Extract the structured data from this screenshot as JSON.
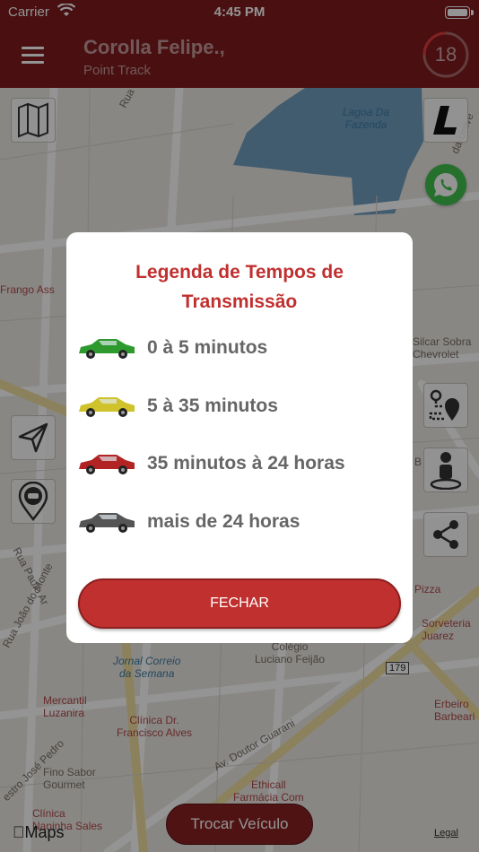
{
  "status_bar": {
    "carrier": "Carrier",
    "time": "4:45 PM"
  },
  "header": {
    "title": "Corolla Felipe.,",
    "subtitle": "Point Track",
    "counter": "18"
  },
  "map": {
    "labels": {
      "lagoa": "Lagoa Da\nFazenda",
      "rua_coronel": "Rua Coronel D",
      "frango": "Frango Ass",
      "silcar": "Silcar Sobra\nChevrolet",
      "rua_paulo": "Rua Paulo Ar",
      "rua_joao": "Rua João do Monte",
      "jornal": "Jornal Correio\nda Semana",
      "colegio": "Colégio\nLuciano Feijão",
      "road_179": "179",
      "pizza": "Pizza",
      "sorveteria": "Sorveteria\nJuarez",
      "erbeiro": "Erbeiro\nBarbeari",
      "mercantil": "Mercantil\nLuzanira",
      "clinica_dr": "Clínica Dr.\nFrancisco Alves",
      "av_doutor": "Av. Doutor Guarani",
      "jose_pedro": "estro José Pedro",
      "fino_sabor": "Fino Sabor\nGourmet",
      "ethicall": "Ethicall\nFarmácia Com\nManipulação",
      "clinica_naninha": "Clínica\nNaninha Sales",
      "rua_univ": "da Unive",
      "rua_b": "B"
    },
    "legal": "Legal",
    "brand": "Maps",
    "trocar_label": "Trocar Veículo"
  },
  "modal": {
    "title": "Legenda de Tempos de Transmissão",
    "items": [
      {
        "label": "0 à 5 minutos",
        "color": "#2e9a2e"
      },
      {
        "label": "5 à 35 minutos",
        "color": "#cfc22a"
      },
      {
        "label": "35 minutos à 24 horas",
        "color": "#b22323"
      },
      {
        "label": "mais de 24 horas",
        "color": "#555555"
      }
    ],
    "close_label": "FECHAR"
  },
  "colors": {
    "brand": "#7e1b1e",
    "accent": "#c0302f",
    "whatsapp": "#3fc14d"
  }
}
